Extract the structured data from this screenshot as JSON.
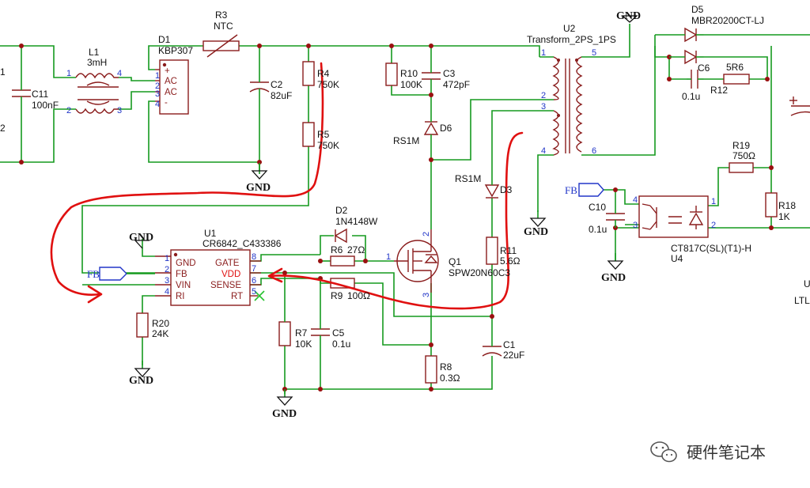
{
  "components": {
    "c11": {
      "ref": "C11",
      "value": "100nF"
    },
    "l1": {
      "ref": "L1",
      "value": "3mH"
    },
    "d1": {
      "ref": "D1",
      "value": "KBP307",
      "pins": [
        "+",
        "AC",
        "AC",
        "-"
      ]
    },
    "r3": {
      "ref": "R3",
      "value": "NTC"
    },
    "c2": {
      "ref": "C2",
      "value": "82uF"
    },
    "r4": {
      "ref": "R4",
      "value": "750K"
    },
    "r5": {
      "ref": "R5",
      "value": "750K"
    },
    "r10": {
      "ref": "R10",
      "value": "100K"
    },
    "c3": {
      "ref": "C3",
      "value": "472pF"
    },
    "d6": {
      "ref": "D6",
      "value": "RS1M"
    },
    "u2": {
      "ref": "U2",
      "value": "Transform_2PS_1PS"
    },
    "d5": {
      "ref": "D5",
      "value": "MBR20200CT-LJ"
    },
    "c6": {
      "ref": "C6",
      "value": "0.1u"
    },
    "r6b": {
      "ref": "5R6",
      "value": "R12"
    },
    "r19": {
      "ref": "R19",
      "value": "750Ω"
    },
    "r18": {
      "ref": "R18",
      "value": "1K"
    },
    "u4": {
      "ref": "U4",
      "value": "CT817C(SL)(T1)-H"
    },
    "c10": {
      "ref": "C10",
      "value": "0.1u"
    },
    "d3": {
      "ref": "D3",
      "value": "RS1M"
    },
    "r11": {
      "ref": "R11",
      "value": "5.6Ω"
    },
    "q1": {
      "ref": "Q1",
      "value": "SPW20N60C3"
    },
    "c1": {
      "ref": "C1",
      "value": "22uF"
    },
    "r8": {
      "ref": "R8",
      "value": "0.3Ω"
    },
    "d2": {
      "ref": "D2",
      "value": "1N4148W"
    },
    "r6": {
      "ref": "R6",
      "value": "27Ω"
    },
    "r9": {
      "ref": "R9",
      "value": "100Ω"
    },
    "r7": {
      "ref": "R7",
      "value": "10K"
    },
    "c5": {
      "ref": "C5",
      "value": "0.1u"
    },
    "r20": {
      "ref": "R20",
      "value": "24K"
    },
    "u1": {
      "ref": "U1",
      "value": "CR6842_C433386",
      "left_pins": [
        "GND",
        "FB",
        "VIN",
        "RI"
      ],
      "right_pins": [
        "GATE",
        "VDD",
        "SENSE",
        "RT"
      ]
    }
  },
  "pin_numbers": {
    "one": "1",
    "two": "2",
    "three": "3",
    "four": "4",
    "five": "5",
    "six": "6",
    "seven": "7",
    "eight": "8"
  },
  "net_labels": {
    "gnd": "GND",
    "fb": "FB"
  },
  "edge_fragments": {
    "left_a": "1",
    "left_b": "2",
    "right_a": "U",
    "right_b": "LTL"
  },
  "watermark": {
    "text": "硬件笔记本"
  },
  "colors": {
    "wire": "#159a1f",
    "component": "#8a1c1c",
    "pin_number": "#2236c8",
    "annotation": "#e01010"
  }
}
